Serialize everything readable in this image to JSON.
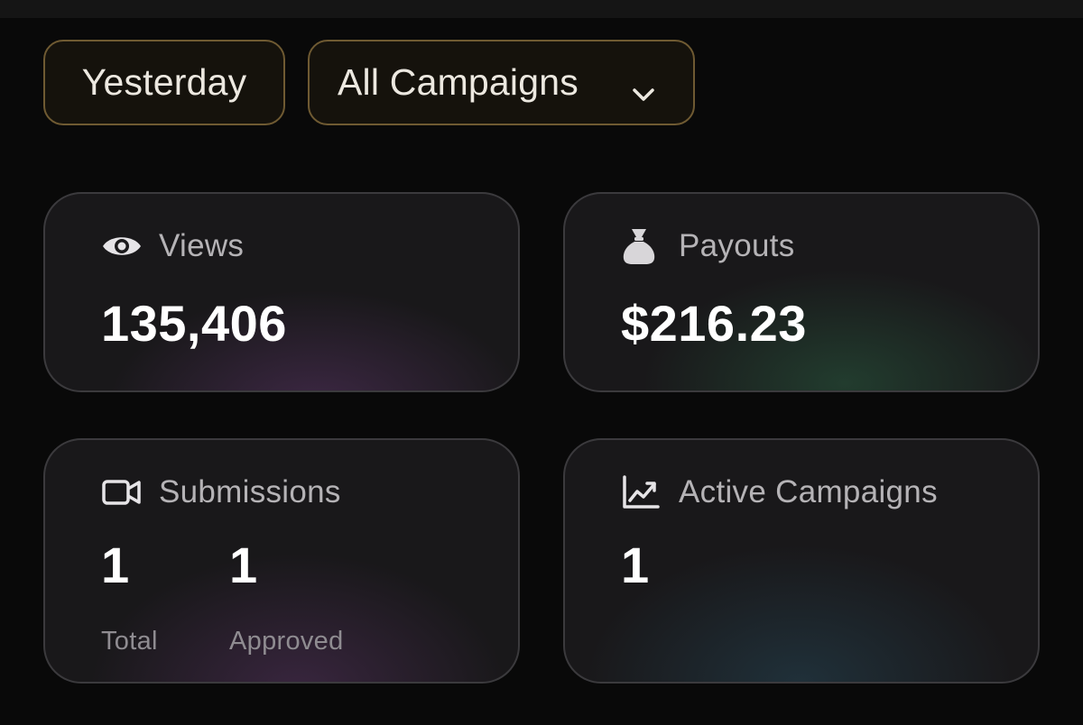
{
  "filters": {
    "date_range": "Yesterday",
    "campaign_select": "All Campaigns"
  },
  "cards": {
    "views": {
      "title": "Views",
      "value": "135,406",
      "icon": "eye-icon"
    },
    "payouts": {
      "title": "Payouts",
      "value": "$216.23",
      "icon": "money-bag-icon"
    },
    "submissions": {
      "title": "Submissions",
      "icon": "video-camera-icon",
      "total_value": "1",
      "total_label": "Total",
      "approved_value": "1",
      "approved_label": "Approved"
    },
    "active_campaigns": {
      "title": "Active Campaigns",
      "value": "1",
      "icon": "trending-chart-icon"
    }
  },
  "colors": {
    "background": "#090909",
    "filter_border": "#6f5a32",
    "card_bg": "#19181a",
    "views_glow": "#703e80",
    "payouts_glow": "#2e6e4a",
    "active_glow": "#284e60"
  }
}
